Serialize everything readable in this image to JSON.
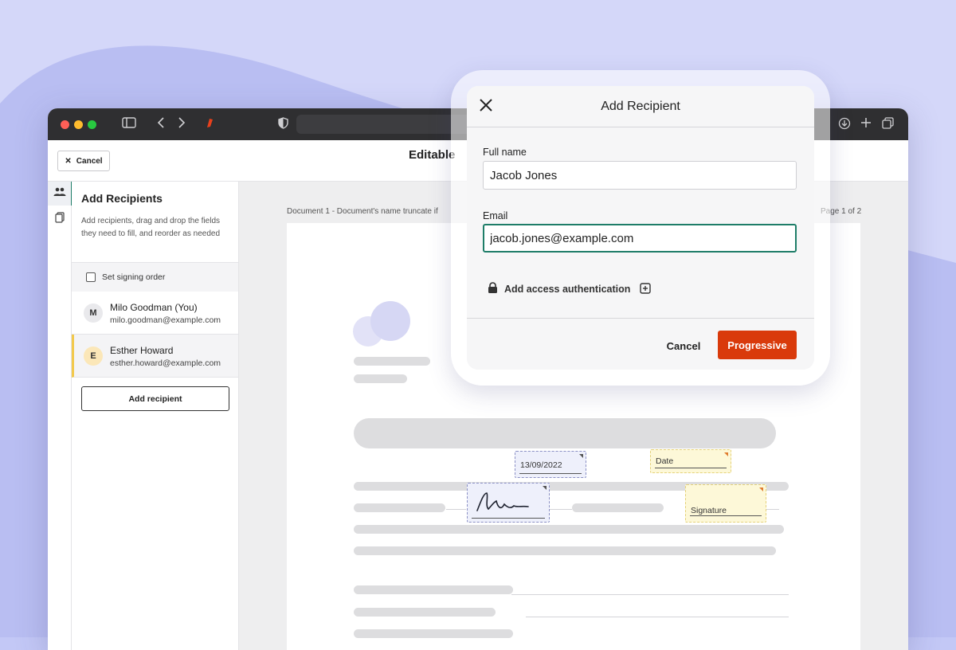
{
  "app": {
    "document_title": "Editable",
    "cancel_label": "Cancel"
  },
  "sidebar": {
    "title": "Add Recipients",
    "description": "Add recipients, drag and drop the fields they need to fill, and reorder as needed",
    "signing_order_label": "Set signing order",
    "signing_order_checked": false,
    "recipients": [
      {
        "initial": "M",
        "name": "Milo Goodman (You)",
        "email": "milo.goodman@example.com",
        "avatar_color": "#e9e9ec"
      },
      {
        "initial": "E",
        "name": "Esther Howard",
        "email": "esther.howard@example.com",
        "avatar_color": "#fbe7b8"
      }
    ],
    "add_recipient_label": "Add recipient"
  },
  "document": {
    "name": "Document 1 - Document's name truncate if",
    "page_indicator": "Page 1 of 2",
    "fields": {
      "date_value": "13/09/2022",
      "date_placeholder": "Date",
      "signature_placeholder": "Signature"
    }
  },
  "modal": {
    "title": "Add Recipient",
    "full_name_label": "Full name",
    "full_name_value": "Jacob Jones",
    "email_label": "Email",
    "email_value": "jacob.jones@example.com",
    "auth_label": "Add access authentication",
    "cancel_label": "Cancel",
    "primary_label": "Progressive"
  },
  "colors": {
    "accent": "#1e7d68",
    "primary_button": "#d93a0b",
    "background": "#c3c8f6"
  },
  "icons": {
    "close": "close-icon",
    "lock": "lock-icon",
    "add_box": "plus-square-icon",
    "recipients": "people-icon",
    "pages": "copy-icon"
  }
}
